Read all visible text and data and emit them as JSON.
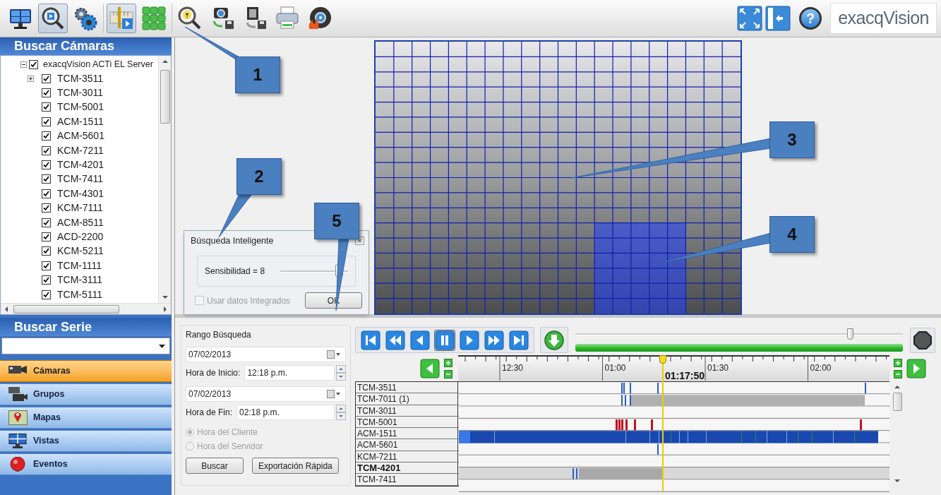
{
  "toolbar": {
    "groups": [
      [
        {
          "kind": "monitor",
          "selected": false
        },
        {
          "kind": "search",
          "selected": true
        },
        {
          "kind": "gears",
          "selected": false
        }
      ],
      [
        {
          "kind": "timeline",
          "selected": true
        },
        {
          "kind": "grid",
          "selected": false
        }
      ],
      [
        {
          "kind": "smart-search",
          "selected": false
        },
        {
          "kind": "camera-save",
          "selected": false
        },
        {
          "kind": "film-save",
          "selected": false
        },
        {
          "kind": "printer",
          "selected": false
        },
        {
          "kind": "disc",
          "selected": false
        }
      ]
    ],
    "right_tools": [
      {
        "kind": "expand"
      },
      {
        "kind": "panel"
      },
      {
        "kind": "help",
        "label": "?"
      }
    ],
    "logo": "exacqVision"
  },
  "camera_search": {
    "title": "Buscar Cámaras",
    "tree": {
      "label": "exacqVision ACTi EL Server",
      "checked": true,
      "expandable": true,
      "expanded": true,
      "children": [
        {
          "label": "TCM-3511",
          "checked": true,
          "expandable": true,
          "expanded": false
        },
        {
          "label": "TCM-3011",
          "checked": true,
          "expandable": false
        },
        {
          "label": "TCM-5001",
          "checked": true,
          "expandable": false
        },
        {
          "label": "ACM-1511",
          "checked": true,
          "expandable": false
        },
        {
          "label": "ACM-5601",
          "checked": true,
          "expandable": false
        },
        {
          "label": "KCM-7211",
          "checked": true,
          "expandable": false
        },
        {
          "label": "TCM-4201",
          "checked": true,
          "expandable": false
        },
        {
          "label": "TCM-7411",
          "checked": true,
          "expandable": false
        },
        {
          "label": "TCM-4301",
          "checked": true,
          "expandable": false
        },
        {
          "label": "KCM-7111",
          "checked": true,
          "expandable": false
        },
        {
          "label": "ACM-8511",
          "checked": true,
          "expandable": false
        },
        {
          "label": "ACD-2200",
          "checked": true,
          "expandable": false
        },
        {
          "label": "KCM-5211",
          "checked": true,
          "expandable": false
        },
        {
          "label": "TCM-1111",
          "checked": true,
          "expandable": false
        },
        {
          "label": "TCM-3111",
          "checked": true,
          "expandable": false
        },
        {
          "label": "TCM-5111",
          "checked": true,
          "expandable": false
        }
      ]
    }
  },
  "series_search": {
    "title": "Buscar Serie"
  },
  "nav": [
    {
      "kind": "cameras",
      "label": "Cámaras",
      "selected": true
    },
    {
      "kind": "groups",
      "label": "Grupos",
      "selected": false
    },
    {
      "kind": "maps",
      "label": "Mapas",
      "selected": false
    },
    {
      "kind": "views",
      "label": "Vistas",
      "selected": false
    },
    {
      "kind": "events",
      "label": "Eventos",
      "selected": false
    }
  ],
  "callouts": [
    {
      "label": "1"
    },
    {
      "label": "2"
    },
    {
      "label": "3"
    },
    {
      "label": "4"
    },
    {
      "label": "5"
    }
  ],
  "dialog": {
    "title": "Búsqueda Inteligente",
    "sensitivity": {
      "label": "Sensibilidad = 8",
      "level": 0.88
    },
    "integrated": {
      "label": "Usar datos Integrados",
      "checked": false,
      "disabled": true
    },
    "ok": "OK"
  },
  "search_range": {
    "title": "Rango Búsqueda",
    "start_date": "07/02/2013",
    "start_time_label": "Hora de Inicio:",
    "start_time": "12:18 p.m.",
    "end_date": "07/02/2013",
    "end_time_label": "Hora de Fin:",
    "end_time": "02:18 p.m.",
    "time_source": [
      {
        "label": "Hora del Cliente",
        "selected": true,
        "disabled": true
      },
      {
        "label": "Hora del Servidor",
        "selected": false,
        "disabled": true
      }
    ],
    "buttons": [
      "Buscar",
      "Exportación Rápida"
    ]
  },
  "playback": {
    "controls": [
      {
        "kind": "first",
        "selected": false
      },
      {
        "kind": "rewind",
        "selected": false
      },
      {
        "kind": "back",
        "selected": false
      },
      {
        "kind": "pause",
        "selected": true
      },
      {
        "kind": "play",
        "selected": false
      },
      {
        "kind": "forward",
        "selected": false
      },
      {
        "kind": "last",
        "selected": false
      }
    ],
    "position": {
      "level": 0.84
    },
    "progress": {
      "level": 1.0
    }
  },
  "timeline": {
    "ticks": [
      "12:30",
      "01:00",
      "01:30",
      "02:00"
    ],
    "playhead": "01:17:50",
    "rows": [
      {
        "label": "TCM-3511",
        "selected": false
      },
      {
        "label": "TCM-7011 (1)",
        "selected": false
      },
      {
        "label": "TCM-3011",
        "selected": false
      },
      {
        "label": "TCM-5001",
        "selected": false
      },
      {
        "label": "ACM-1511",
        "selected": false
      },
      {
        "label": "ACM-5601",
        "selected": false
      },
      {
        "label": "KCM-7211",
        "selected": false
      },
      {
        "label": "TCM-4201",
        "selected": true
      },
      {
        "label": "TCM-7411",
        "selected": false
      }
    ]
  }
}
